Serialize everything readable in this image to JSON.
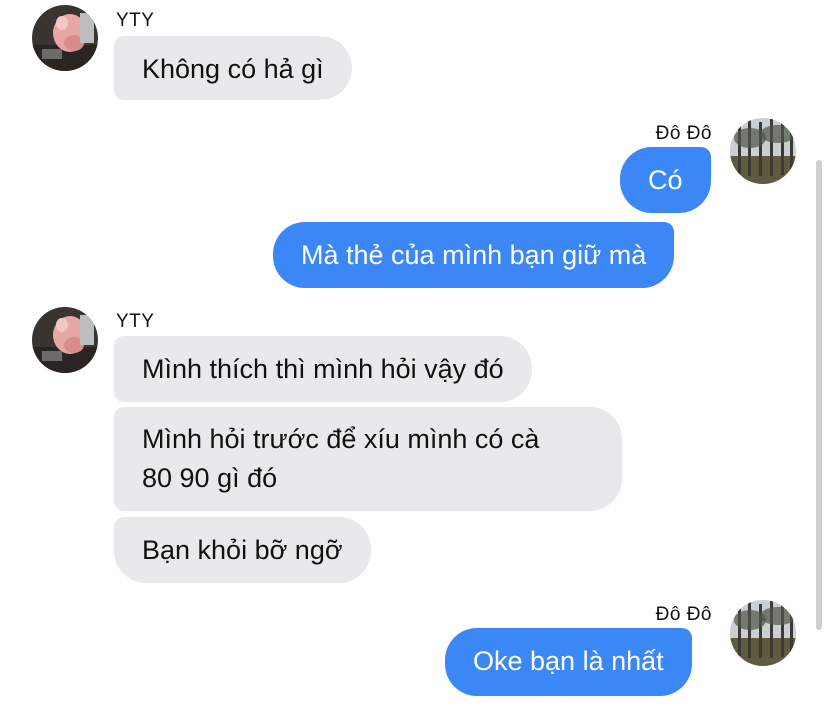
{
  "colors": {
    "incoming_bubble": "#e9e9eb",
    "outgoing_bubble": "#3b87f6",
    "outgoing_text": "#ffffff"
  },
  "messages": {
    "group1": {
      "sender": "YTY",
      "bubble1": "Không có hả gì"
    },
    "group2": {
      "sender": "Đô Đô",
      "bubble1": "Có",
      "bubble2": "Mà thẻ của mình bạn giữ mà"
    },
    "group3": {
      "sender": "YTY",
      "bubble1": "Mình thích thì mình hỏi vậy đó",
      "bubble2_line1": "Mình hỏi trước để xíu mình có cà",
      "bubble2_line2": "80 90 gì đó",
      "bubble3": "Bạn khỏi bỡ ngỡ"
    },
    "group4": {
      "sender": "Đô Đô",
      "bubble1": "Oke bạn là nhất"
    }
  }
}
